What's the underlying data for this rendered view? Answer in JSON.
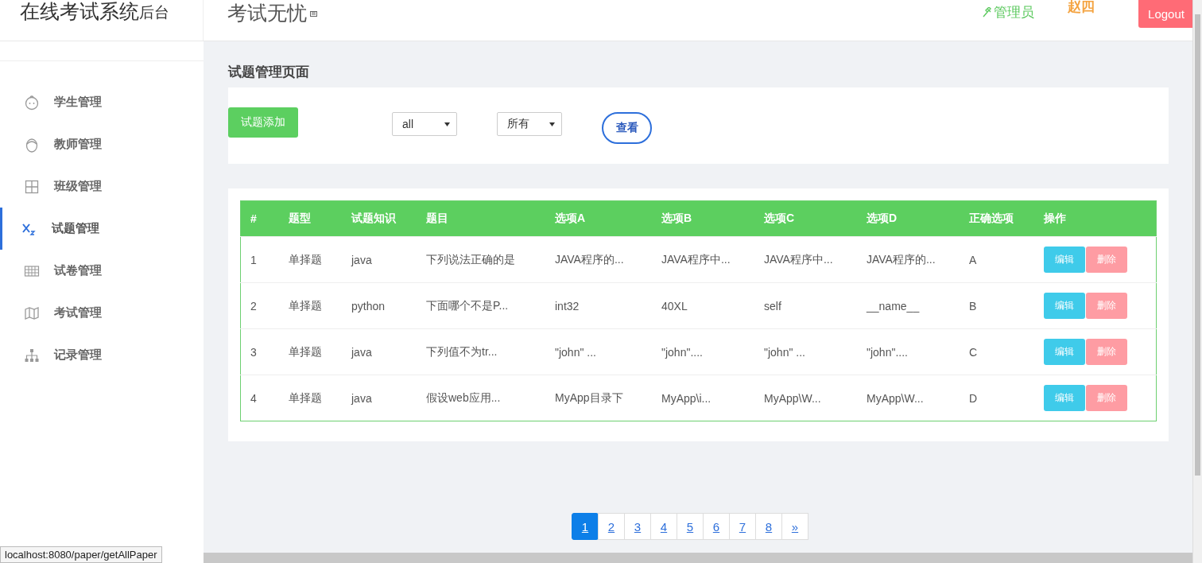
{
  "header": {
    "brand_main": "在线考试系统",
    "brand_suffix": "后台",
    "title": "考试无忧",
    "role": "管理员",
    "user": "赵四",
    "logout": "Logout"
  },
  "sidebar": {
    "items": [
      {
        "label": "学生管理",
        "selected": false
      },
      {
        "label": "教师管理",
        "selected": false
      },
      {
        "label": "班级管理",
        "selected": false
      },
      {
        "label": "试题管理",
        "selected": true
      },
      {
        "label": "试卷管理",
        "selected": false
      },
      {
        "label": "考试管理",
        "selected": false
      },
      {
        "label": "记录管理",
        "selected": false
      }
    ]
  },
  "page_title": "试题管理页面",
  "filters": {
    "add_button": "试题添加",
    "subject_select": "all",
    "type_select": "所有",
    "view_button": "查看"
  },
  "table": {
    "columns": [
      "#",
      "题型",
      "试题知识",
      "题目",
      "选项A",
      "选项B",
      "选项C",
      "选项D",
      "正确选项",
      "操作"
    ],
    "rows": [
      {
        "cells": [
          "1",
          "单择题",
          "java",
          "下列说法正确的是",
          "JAVA程序的...",
          "JAVA程序中...",
          "JAVA程序中...",
          "JAVA程序的...",
          "A"
        ],
        "edit": "编辑",
        "delete": "删除"
      },
      {
        "cells": [
          "2",
          "单择题",
          "python",
          "下面哪个不是P...",
          "int32",
          "40XL",
          "self",
          "__name__",
          "B"
        ],
        "edit": "编辑",
        "delete": "删除"
      },
      {
        "cells": [
          "3",
          "单择题",
          "java",
          "下列值不为tr...",
          "\"john\" ...",
          "\"john\"....",
          "\"john\" ...",
          "\"john\"....",
          "C"
        ],
        "edit": "编辑",
        "delete": "删除"
      },
      {
        "cells": [
          "4",
          "单择题",
          "java",
          "假设web应用...",
          "MyApp目录下",
          "MyApp\\i...",
          "MyApp\\W...",
          "MyApp\\W...",
          "D"
        ],
        "edit": "编辑",
        "delete": "删除"
      }
    ]
  },
  "pagination": [
    {
      "label": "1",
      "selected": true
    },
    {
      "label": "2",
      "selected": false
    },
    {
      "label": "3",
      "selected": false
    },
    {
      "label": "4",
      "selected": false
    },
    {
      "label": "5",
      "selected": false
    },
    {
      "label": "6",
      "selected": false
    },
    {
      "label": "7",
      "selected": false
    },
    {
      "label": "8",
      "selected": false
    },
    {
      "label": "»",
      "selected": false
    }
  ],
  "status_url": "localhost:8080/paper/getAllPaper"
}
